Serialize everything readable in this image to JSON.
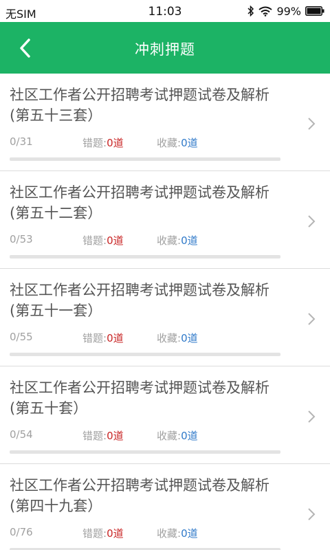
{
  "status_bar": {
    "carrier": "无SIM",
    "time": "11:03",
    "battery": "99%",
    "icons": [
      "bluetooth-icon",
      "wifi-icon",
      "battery-icon"
    ]
  },
  "header": {
    "title": "冲刺押题",
    "back_icon": "chevron-left-icon",
    "color": "#1cb365"
  },
  "labels": {
    "wrong": "错题:",
    "fav": "收藏:"
  },
  "items": [
    {
      "name": "社区工作者公开招聘考试押题试卷及解析(第五十三套）",
      "progress": "0/31",
      "progress_fraction": 0,
      "wrong": "0道",
      "fav": "0道"
    },
    {
      "name": "社区工作者公开招聘考试押题试卷及解析(第五十二套）",
      "progress": "0/53",
      "progress_fraction": 0,
      "wrong": "0道",
      "fav": "0道"
    },
    {
      "name": "社区工作者公开招聘考试押题试卷及解析(第五十一套）",
      "progress": "0/55",
      "progress_fraction": 0,
      "wrong": "0道",
      "fav": "0道"
    },
    {
      "name": "社区工作者公开招聘考试押题试卷及解析(第五十套）",
      "progress": "0/54",
      "progress_fraction": 0,
      "wrong": "0道",
      "fav": "0道"
    },
    {
      "name": "社区工作者公开招聘考试押题试卷及解析(第四十九套）",
      "progress": "0/76",
      "progress_fraction": 0,
      "wrong": "0道",
      "fav": "0道"
    }
  ]
}
